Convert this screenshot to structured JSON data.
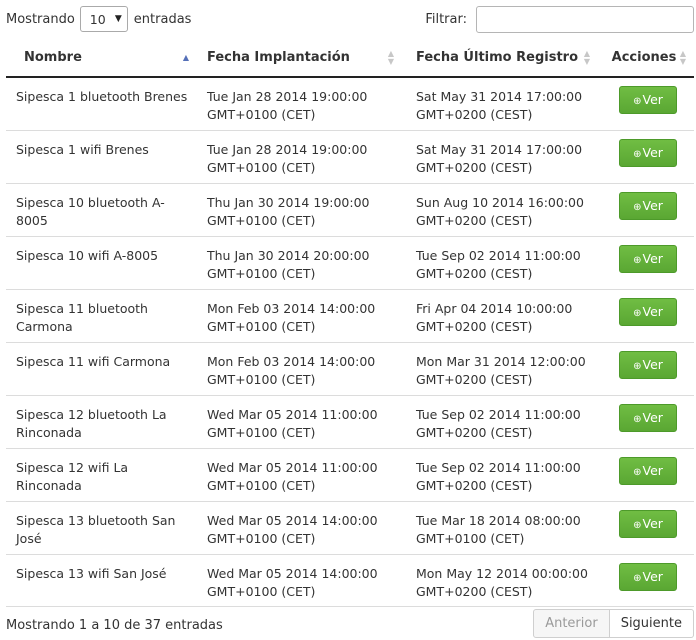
{
  "controls": {
    "length_prefix": "Mostrando",
    "length_value": "10",
    "length_suffix": "entradas",
    "filter_label": "Filtrar:",
    "filter_value": ""
  },
  "table": {
    "columns": [
      "Nombre",
      "Fecha Implantación",
      "Fecha Último Registro",
      "Acciones"
    ],
    "rows": [
      {
        "nombre": "Sipesca 1 bluetooth Brenes",
        "implantacion": "Tue Jan 28 2014 19:00:00 GMT+0100 (CET)",
        "registro": "Sat May 31 2014 17:00:00 GMT+0200 (CEST)",
        "accion": "Ver"
      },
      {
        "nombre": "Sipesca 1 wifi Brenes",
        "implantacion": "Tue Jan 28 2014 19:00:00 GMT+0100 (CET)",
        "registro": "Sat May 31 2014 17:00:00 GMT+0200 (CEST)",
        "accion": "Ver"
      },
      {
        "nombre": "Sipesca 10 bluetooth A-8005",
        "implantacion": "Thu Jan 30 2014 19:00:00 GMT+0100 (CET)",
        "registro": "Sun Aug 10 2014 16:00:00 GMT+0200 (CEST)",
        "accion": "Ver"
      },
      {
        "nombre": "Sipesca 10 wifi A-8005",
        "implantacion": "Thu Jan 30 2014 20:00:00 GMT+0100 (CET)",
        "registro": "Tue Sep 02 2014 11:00:00 GMT+0200 (CEST)",
        "accion": "Ver"
      },
      {
        "nombre": "Sipesca 11 bluetooth Carmona",
        "implantacion": "Mon Feb 03 2014 14:00:00 GMT+0100 (CET)",
        "registro": "Fri Apr 04 2014 10:00:00 GMT+0200 (CEST)",
        "accion": "Ver"
      },
      {
        "nombre": "Sipesca 11 wifi Carmona",
        "implantacion": "Mon Feb 03 2014 14:00:00 GMT+0100 (CET)",
        "registro": "Mon Mar 31 2014 12:00:00 GMT+0200 (CEST)",
        "accion": "Ver"
      },
      {
        "nombre": "Sipesca 12 bluetooth La Rinconada",
        "implantacion": "Wed Mar 05 2014 11:00:00 GMT+0100 (CET)",
        "registro": "Tue Sep 02 2014 11:00:00 GMT+0200 (CEST)",
        "accion": "Ver"
      },
      {
        "nombre": "Sipesca 12 wifi La Rinconada",
        "implantacion": "Wed Mar 05 2014 11:00:00 GMT+0100 (CET)",
        "registro": "Tue Sep 02 2014 11:00:00 GMT+0200 (CEST)",
        "accion": "Ver"
      },
      {
        "nombre": "Sipesca 13 bluetooth San José",
        "implantacion": "Wed Mar 05 2014 14:00:00 GMT+0100 (CET)",
        "registro": "Tue Mar 18 2014 08:00:00 GMT+0100 (CET)",
        "accion": "Ver"
      },
      {
        "nombre": "Sipesca 13 wifi San José",
        "implantacion": "Wed Mar 05 2014 14:00:00 GMT+0100 (CET)",
        "registro": "Mon May 12 2014 00:00:00 GMT+0200 (CEST)",
        "accion": "Ver"
      }
    ]
  },
  "footer": {
    "info": "Mostrando 1 a 10 de 37 entradas",
    "prev_label": "Anterior",
    "next_label": "Siguiente"
  },
  "icons": {
    "view": "magnifier-plus-icon",
    "sort_asc": "sort-up-icon",
    "sort_both": "sort-both-icon"
  },
  "colors": {
    "button_green": "#62b03a",
    "sort_active": "#5570b8",
    "sort_inactive": "#c7c7c7"
  }
}
